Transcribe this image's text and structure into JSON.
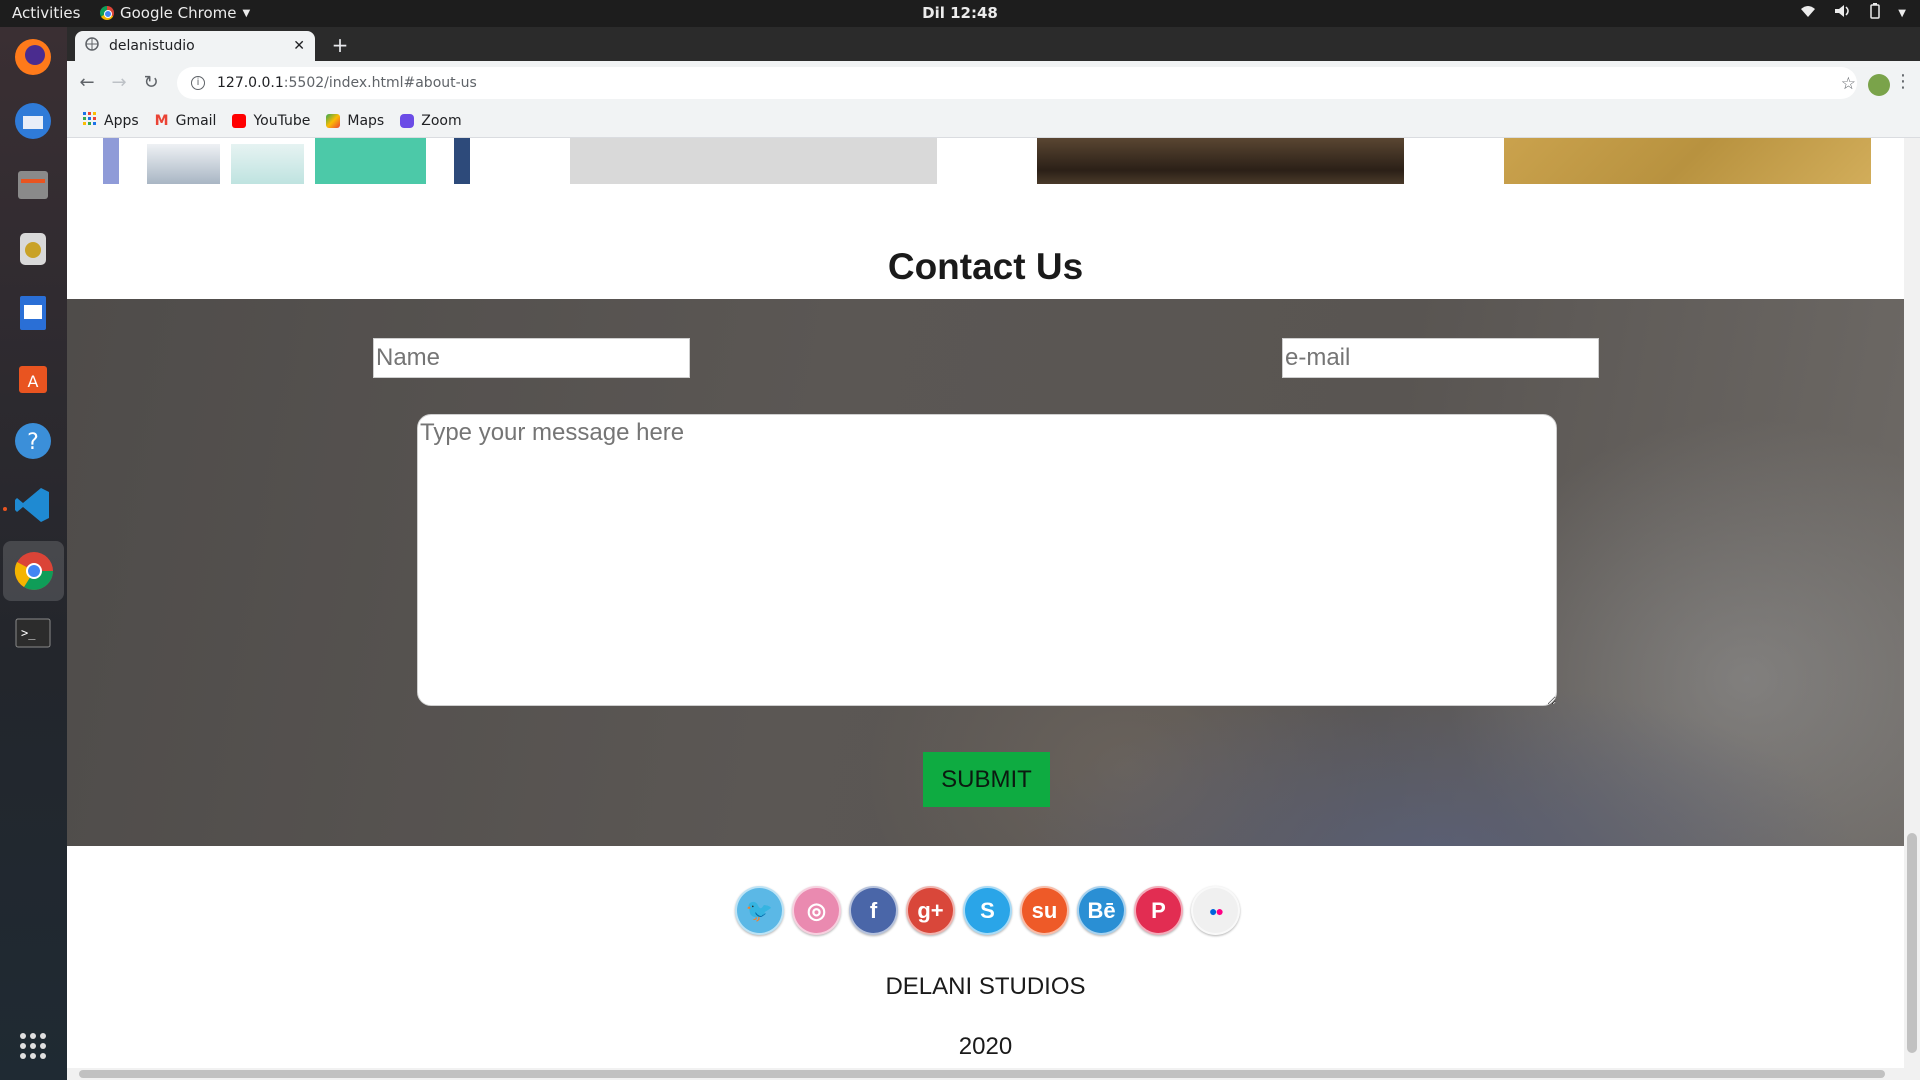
{
  "topbar": {
    "activities": "Activities",
    "app_menu": "Google Chrome",
    "clock": "Dil 12:48"
  },
  "browser": {
    "tab_title": "delanistudio",
    "url_host": "127.0.0.1",
    "url_rest": ":5502/index.html#about-us",
    "bookmarks": [
      "Apps",
      "Gmail",
      "YouTube",
      "Maps",
      "Zoom"
    ]
  },
  "page": {
    "contact_title": "Contact Us",
    "name_placeholder": "Name",
    "email_placeholder": "e-mail",
    "message_placeholder": "Type your message here",
    "submit_label": "SUBMIT",
    "social": [
      {
        "name": "twitter",
        "glyph": "🐦",
        "color": "#5bb8e6"
      },
      {
        "name": "dribbble",
        "glyph": "◎",
        "color": "#ea8ab0"
      },
      {
        "name": "facebook",
        "glyph": "f",
        "color": "#4a66a8"
      },
      {
        "name": "google-plus",
        "glyph": "g+",
        "color": "#d9473a"
      },
      {
        "name": "skype",
        "glyph": "S",
        "color": "#2aa5e8"
      },
      {
        "name": "stumbleupon",
        "glyph": "su",
        "color": "#ee5a28"
      },
      {
        "name": "behance",
        "glyph": "Bē",
        "color": "#2a8fd4"
      },
      {
        "name": "pinterest",
        "glyph": "P",
        "color": "#e22d52"
      },
      {
        "name": "flickr",
        "glyph": "●●",
        "color": "#f0f0f0"
      }
    ],
    "footer_brand": "DELANI STUDIOS",
    "footer_year": "2020"
  }
}
